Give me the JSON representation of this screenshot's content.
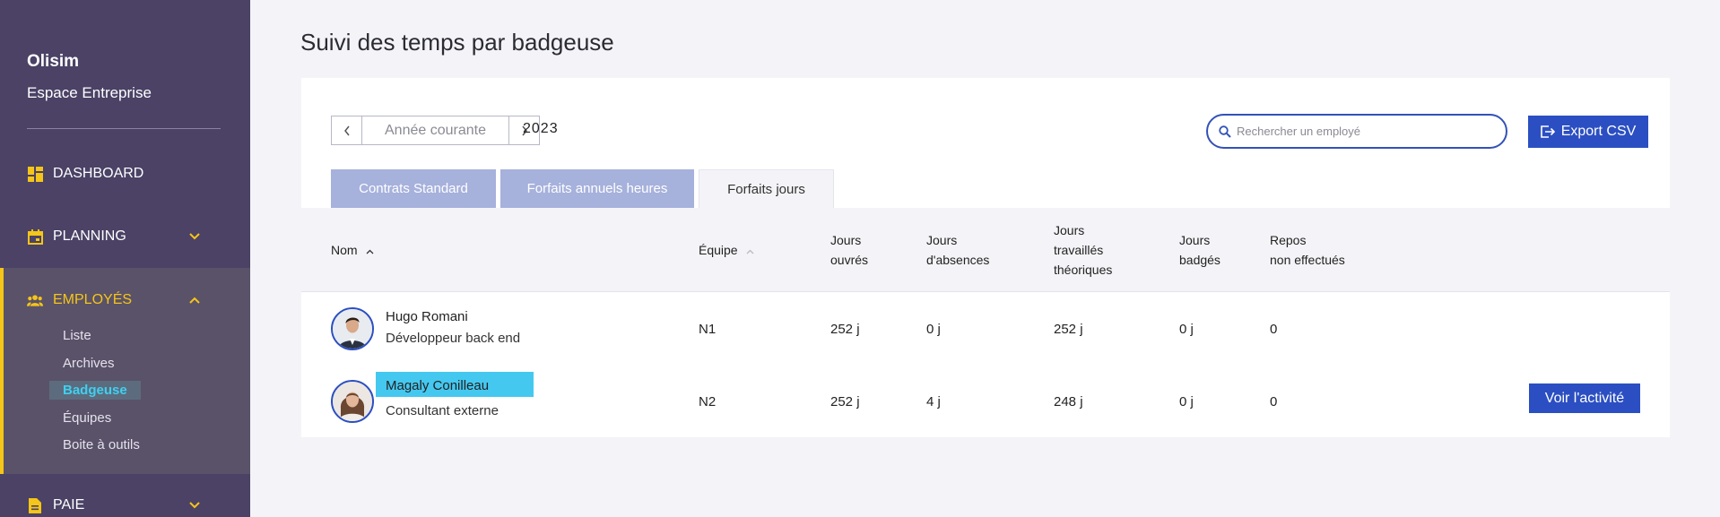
{
  "sidebar": {
    "brand": "Olisim",
    "brand_sub": "Espace Entreprise",
    "nav": [
      {
        "label": "DASHBOARD",
        "icon": "dashboard-icon"
      },
      {
        "label": "PLANNING",
        "icon": "calendar-icon"
      },
      {
        "label": "EMPLOYÉS",
        "icon": "people-icon"
      },
      {
        "label": "PAIE",
        "icon": "document-icon"
      }
    ],
    "subitems": [
      "Liste",
      "Archives",
      "Badgeuse",
      "Équipes",
      "Boite à outils"
    ],
    "accent": "#f5c518",
    "selected_color": "#3fd0f0"
  },
  "page": {
    "title": "Suivi des temps par badgeuse",
    "period_label": "Année courante",
    "year": "2023",
    "search_placeholder": "Rechercher un employé",
    "export_label": "Export CSV",
    "tabs": [
      "Contrats Standard",
      "Forfaits annuels heures",
      "Forfaits jours"
    ],
    "active_tab": "Forfaits jours"
  },
  "table": {
    "headers": {
      "nom": "Nom",
      "equipe": "Équipe",
      "ouvres": [
        "Jours",
        "ouvrés"
      ],
      "absences": [
        "Jours",
        "d'absences"
      ],
      "theoriques": [
        "Jours",
        "travaillés",
        "théoriques"
      ],
      "badges": [
        "Jours",
        "badgés"
      ],
      "repos": [
        "Repos",
        "non effectués"
      ]
    },
    "rows": [
      {
        "name": "Hugo Romani",
        "role": "Développeur back end",
        "team": "N1",
        "ouvres": "252 j",
        "absences": "0 j",
        "theoriques": "252 j",
        "badges": "0 j",
        "repos": "0"
      },
      {
        "name": "Magaly Conilleau",
        "role": "Consultant externe",
        "team": "N2",
        "ouvres": "252 j",
        "absences": "4 j",
        "theoriques": "248 j",
        "badges": "0 j",
        "repos": "0",
        "action": "Voir l'activité"
      }
    ]
  },
  "colors": {
    "primary": "#2b4fc2",
    "sidebar_bg": "#4b4266",
    "highlight": "#45c8f0"
  }
}
